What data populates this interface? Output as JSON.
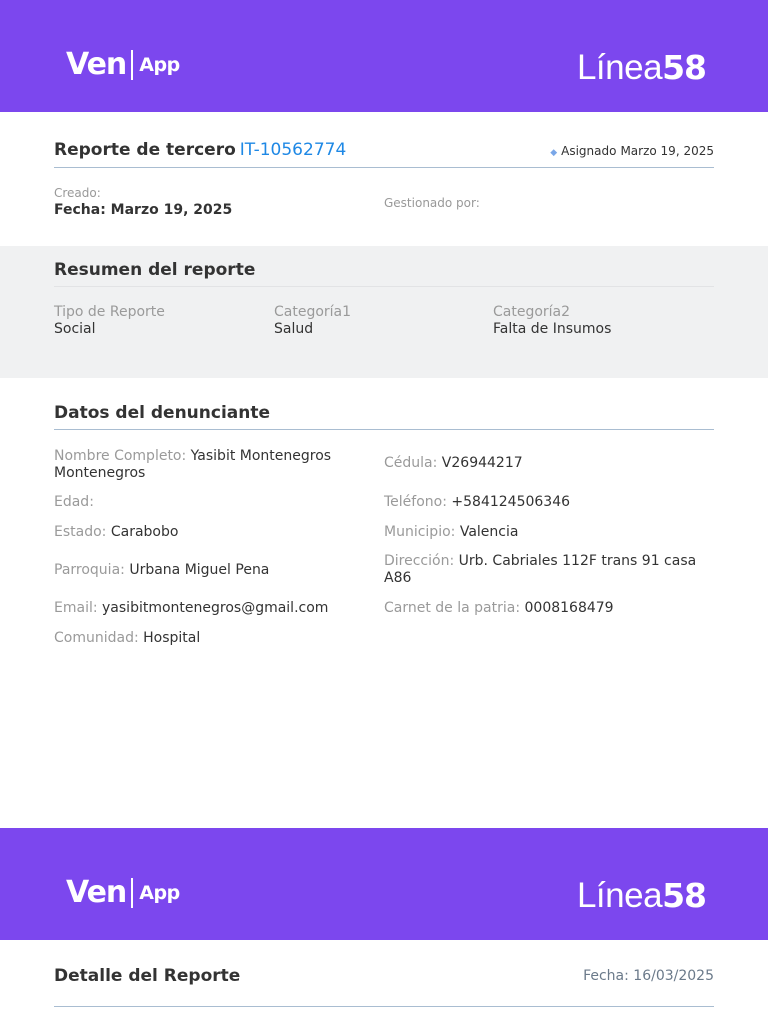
{
  "brand": {
    "left_main": "Ven",
    "left_sub": "App",
    "right_main": "Línea",
    "right_num": "58",
    "banner_color": "#7c47ee"
  },
  "report": {
    "title": "Reporte de tercero",
    "id": "IT-10562774",
    "assigned_label": "Asignado",
    "assigned_date": "Marzo 19, 2025",
    "created_label": "Creado:",
    "created_value": "Fecha: Marzo 19, 2025",
    "managed_label": "Gestionado por:"
  },
  "summary": {
    "title": "Resumen del reporte",
    "items": [
      {
        "label": "Tipo de Reporte",
        "value": "Social"
      },
      {
        "label": "Categoría1",
        "value": "Salud"
      },
      {
        "label": "Categoría2",
        "value": "Falta de Insumos"
      }
    ]
  },
  "complainant": {
    "title": "Datos del denunciante",
    "fields": {
      "nombre": {
        "label": "Nombre Completo:",
        "value": "Yasibit Montenegros Montenegros"
      },
      "cedula": {
        "label": "Cédula:",
        "value": "V26944217"
      },
      "edad": {
        "label": "Edad:",
        "value": ""
      },
      "telefono": {
        "label": "Teléfono:",
        "value": "+584124506346"
      },
      "estado": {
        "label": "Estado:",
        "value": "Carabobo"
      },
      "municipio": {
        "label": "Municipio:",
        "value": "Valencia"
      },
      "parroquia": {
        "label": "Parroquia:",
        "value": "Urbana Miguel Pena"
      },
      "direccion": {
        "label": "Dirección:",
        "value": "Urb. Cabriales 112F trans 91 casa A86"
      },
      "email": {
        "label": "Email:",
        "value": "yasibitmontenegros@gmail.com"
      },
      "carnet": {
        "label": "Carnet de la patria:",
        "value": "0008168479"
      },
      "comunidad": {
        "label": "Comunidad:",
        "value": "Hospital"
      }
    }
  },
  "detail": {
    "title": "Detalle del Reporte",
    "date": "Fecha: 16/03/2025"
  },
  "colors": {
    "accent": "#7c47ee",
    "link": "#1e88e5",
    "summary_bg": "#f0f1f2",
    "rule": "#a9bdd1"
  }
}
